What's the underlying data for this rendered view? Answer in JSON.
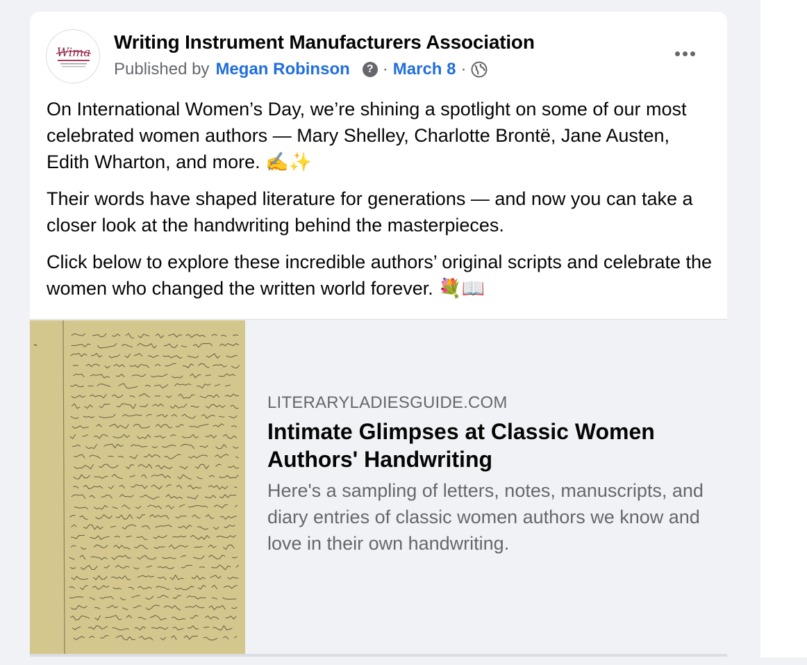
{
  "post": {
    "page_name": "Writing Instrument Manufacturers Association",
    "published_by_prefix": "Published by",
    "author": "Megan Robinson",
    "help_icon_glyph": "?",
    "separator": "·",
    "date": "March 8",
    "audience_icon": "globe-icon",
    "more_icon": "more-horizontal-icon",
    "avatar_logo_text": "Wima",
    "paragraphs": [
      "On International Women’s Day, we’re shining a spotlight on some of our most celebrated women authors — Mary Shelley, Charlotte Brontë, Jane Austen, Edith Wharton, and more. ✍️✨",
      "Their words have shaped literature for generations — and now you can take a closer look at the handwriting behind the masterpieces.",
      "Click below to explore these incredible authors’ original scripts and celebrate the women who changed the written world forever. 💐📖"
    ]
  },
  "link_preview": {
    "domain": "LITERARYLADIESGUIDE.COM",
    "title": "Intimate Glimpses at Classic Women Authors' Handwriting",
    "description": "Here's a sampling of letters, notes, manuscripts, and diary entries of classic women authors we know and love in their own handwriting.",
    "thumbnail": "handwritten-manuscript-image"
  },
  "colors": {
    "link_blue": "#216fdb",
    "secondary_text": "#65676b",
    "primary_text": "#050505",
    "preview_bg": "#f0f2f5",
    "manuscript_paper": "#d9cc95"
  }
}
